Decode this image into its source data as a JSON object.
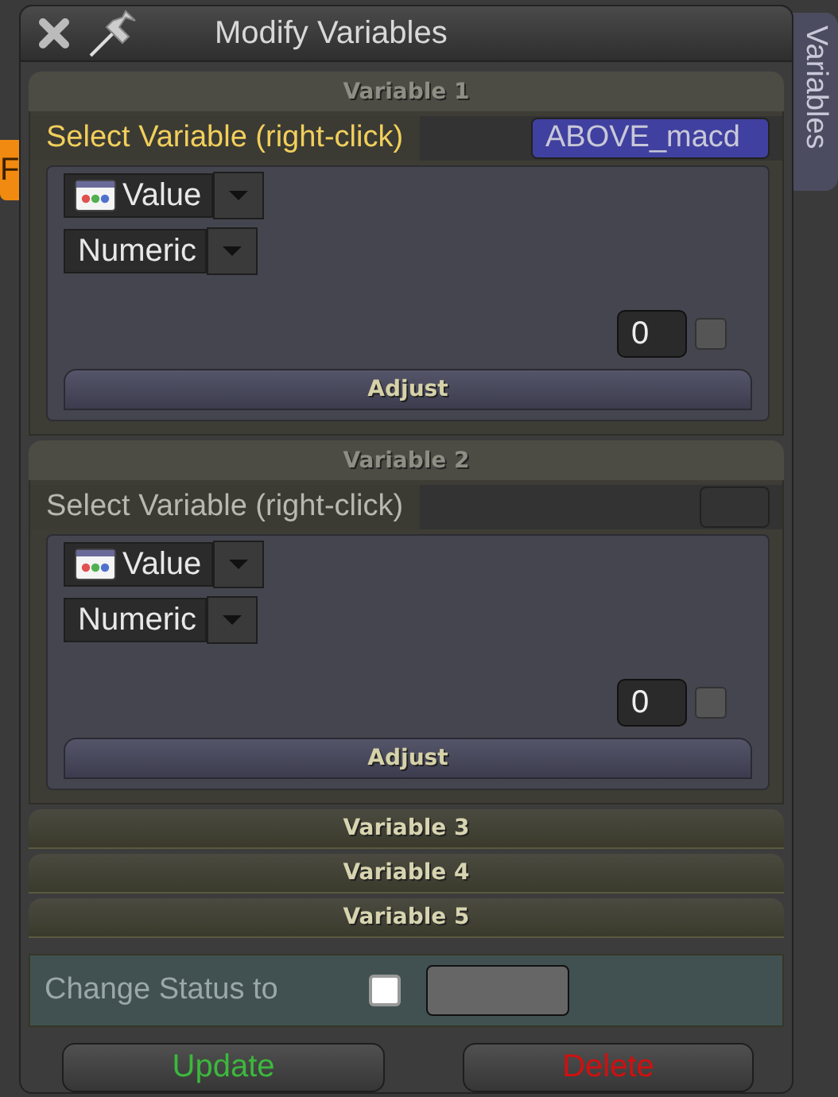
{
  "window": {
    "title": "Modify Variables"
  },
  "side_tab": {
    "label": "Variables"
  },
  "background_tab": {
    "label": "F"
  },
  "variables": [
    {
      "title": "Variable 1",
      "expanded": true,
      "select_label": "Select Variable (right-click)",
      "assigned": true,
      "variable_name": "ABOVE_macd",
      "source": "Value",
      "type": "Numeric",
      "amount": "0",
      "checked": false,
      "adjust_label": "Adjust"
    },
    {
      "title": "Variable 2",
      "expanded": true,
      "select_label": "Select Variable (right-click)",
      "assigned": false,
      "source": "Value",
      "type": "Numeric",
      "amount": "0",
      "checked": false,
      "adjust_label": "Adjust"
    },
    {
      "title": "Variable 3",
      "expanded": false
    },
    {
      "title": "Variable 4",
      "expanded": false
    },
    {
      "title": "Variable 5",
      "expanded": false
    }
  ],
  "status": {
    "label": "Change Status to",
    "checked": false
  },
  "buttons": [
    {
      "label": "Update",
      "kind": "update"
    },
    {
      "label": "Delete",
      "kind": "delete"
    }
  ]
}
